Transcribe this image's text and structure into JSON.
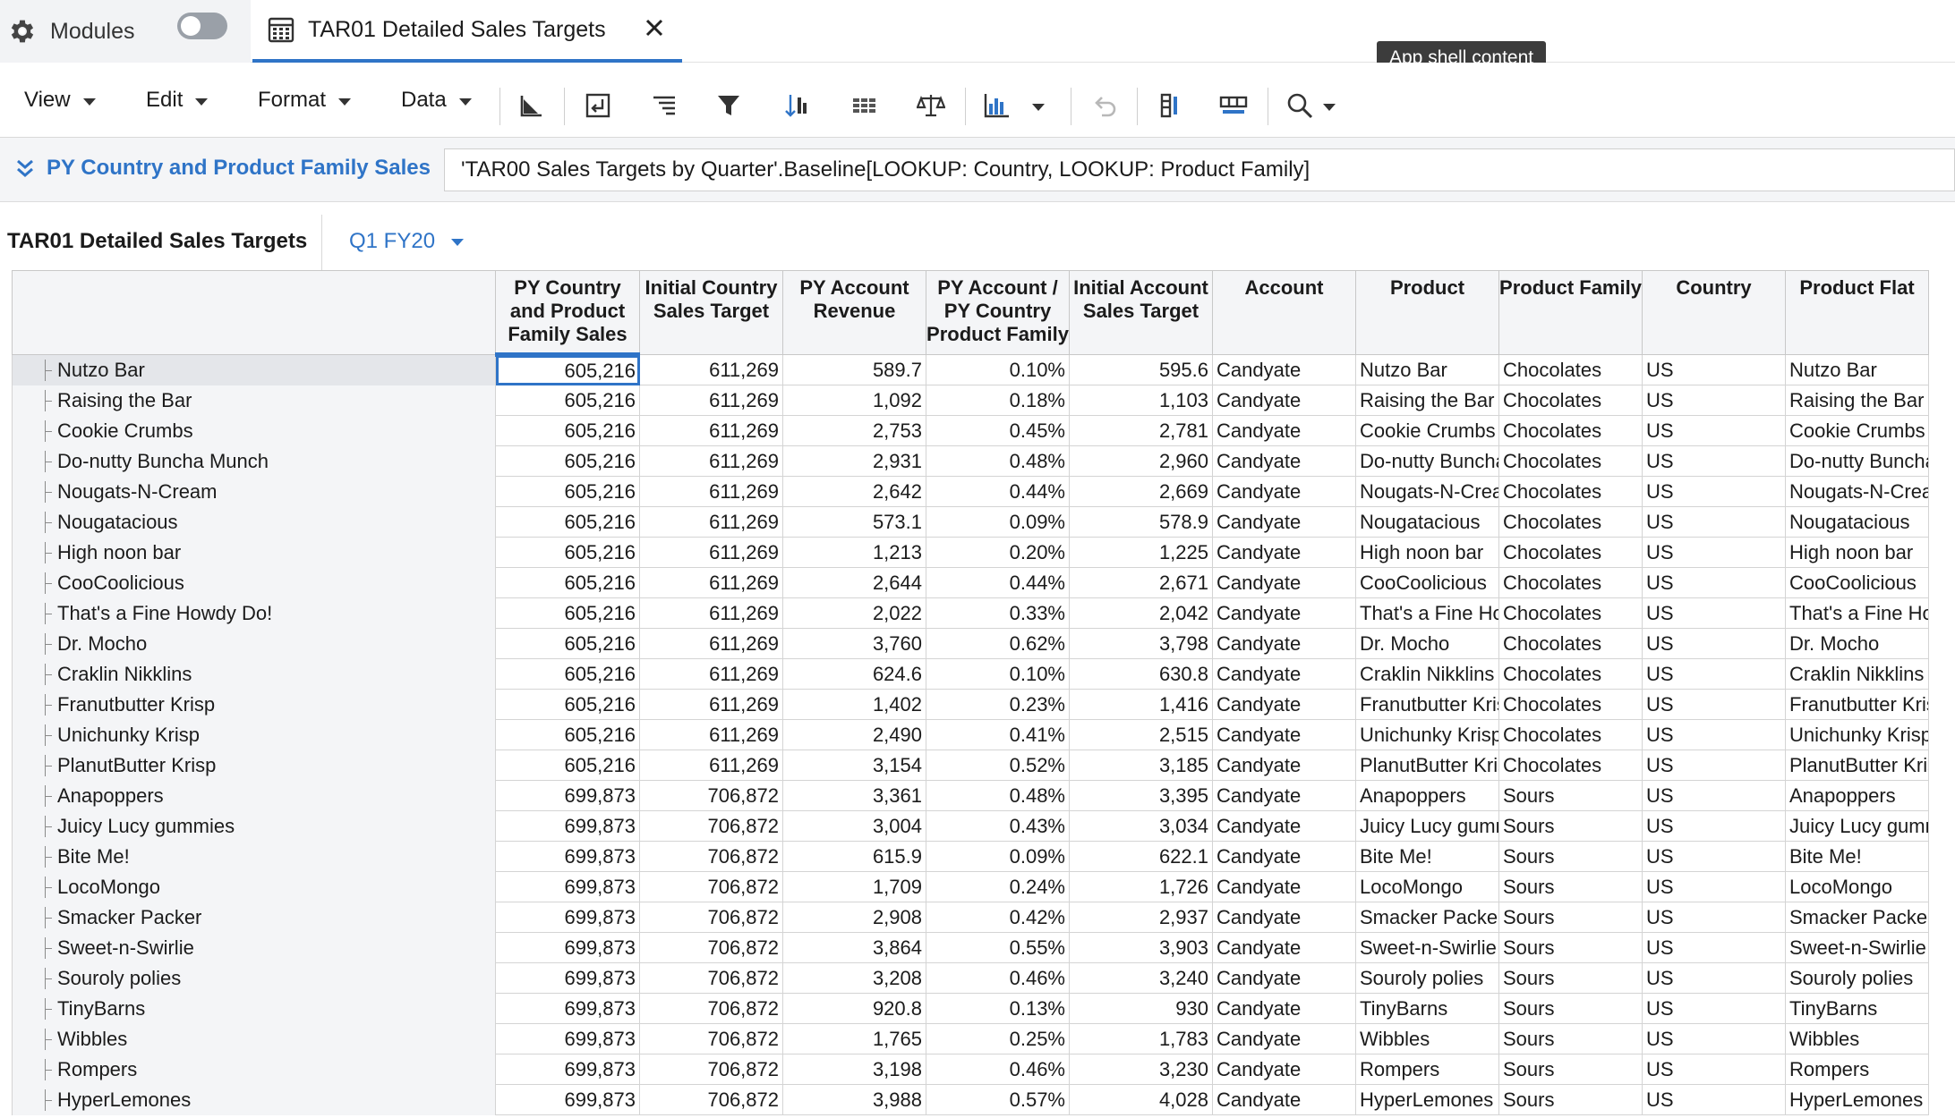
{
  "tabs": {
    "modules_label": "Modules",
    "doc_title": "TAR01 Detailed Sales Targets"
  },
  "tooltip": "App shell content",
  "toolbar": {
    "menus": [
      "View",
      "Edit",
      "Format",
      "Data"
    ]
  },
  "formula": {
    "name": "PY Country and Product Family Sales",
    "expression": "'TAR00 Sales Targets by Quarter'.Baseline[LOOKUP: Country, LOOKUP: Product Family]"
  },
  "grid": {
    "title": "TAR01 Detailed Sales Targets",
    "period": "Q1 FY20",
    "columns": [
      "PY Country and Product Family Sales",
      "Initial Country Sales Target",
      "PY Account Revenue",
      "PY Account / PY Country Product Family",
      "Initial Account Sales Target",
      "Account",
      "Product",
      "Product Family",
      "Country",
      "Product Flat"
    ],
    "rows": [
      [
        "Nutzo Bar",
        "605,216",
        "611,269",
        "589.7",
        "0.10%",
        "595.6",
        "Candyate",
        "Nutzo Bar",
        "Chocolates",
        "US",
        "Nutzo Bar"
      ],
      [
        "Raising the Bar",
        "605,216",
        "611,269",
        "1,092",
        "0.18%",
        "1,103",
        "Candyate",
        "Raising the Bar",
        "Chocolates",
        "US",
        "Raising the Bar"
      ],
      [
        "Cookie Crumbs",
        "605,216",
        "611,269",
        "2,753",
        "0.45%",
        "2,781",
        "Candyate",
        "Cookie Crumbs",
        "Chocolates",
        "US",
        "Cookie Crumbs"
      ],
      [
        "Do-nutty Buncha Munch",
        "605,216",
        "611,269",
        "2,931",
        "0.48%",
        "2,960",
        "Candyate",
        "Do-nutty Buncha Munch",
        "Chocolates",
        "US",
        "Do-nutty Buncha Munch"
      ],
      [
        "Nougats-N-Cream",
        "605,216",
        "611,269",
        "2,642",
        "0.44%",
        "2,669",
        "Candyate",
        "Nougats-N-Cream",
        "Chocolates",
        "US",
        "Nougats-N-Cream"
      ],
      [
        "Nougatacious",
        "605,216",
        "611,269",
        "573.1",
        "0.09%",
        "578.9",
        "Candyate",
        "Nougatacious",
        "Chocolates",
        "US",
        "Nougatacious"
      ],
      [
        "High noon bar",
        "605,216",
        "611,269",
        "1,213",
        "0.20%",
        "1,225",
        "Candyate",
        "High noon bar",
        "Chocolates",
        "US",
        "High noon bar"
      ],
      [
        "CooCoolicious",
        "605,216",
        "611,269",
        "2,644",
        "0.44%",
        "2,671",
        "Candyate",
        "CooCoolicious",
        "Chocolates",
        "US",
        "CooCoolicious"
      ],
      [
        "That's a Fine Howdy Do!",
        "605,216",
        "611,269",
        "2,022",
        "0.33%",
        "2,042",
        "Candyate",
        "That's a Fine Howdy Do!",
        "Chocolates",
        "US",
        "That's a Fine Howdy Do!"
      ],
      [
        "Dr. Mocho",
        "605,216",
        "611,269",
        "3,760",
        "0.62%",
        "3,798",
        "Candyate",
        "Dr. Mocho",
        "Chocolates",
        "US",
        "Dr. Mocho"
      ],
      [
        "Craklin Nikklins",
        "605,216",
        "611,269",
        "624.6",
        "0.10%",
        "630.8",
        "Candyate",
        "Craklin Nikklins",
        "Chocolates",
        "US",
        "Craklin Nikklins"
      ],
      [
        "Franutbutter Krisp",
        "605,216",
        "611,269",
        "1,402",
        "0.23%",
        "1,416",
        "Candyate",
        "Franutbutter Krisp",
        "Chocolates",
        "US",
        "Franutbutter Krisp"
      ],
      [
        "Unichunky Krisp",
        "605,216",
        "611,269",
        "2,490",
        "0.41%",
        "2,515",
        "Candyate",
        "Unichunky Krisp",
        "Chocolates",
        "US",
        "Unichunky Krisp"
      ],
      [
        "PlanutButter Krisp",
        "605,216",
        "611,269",
        "3,154",
        "0.52%",
        "3,185",
        "Candyate",
        "PlanutButter Krisp",
        "Chocolates",
        "US",
        "PlanutButter Krisp"
      ],
      [
        "Anapoppers",
        "699,873",
        "706,872",
        "3,361",
        "0.48%",
        "3,395",
        "Candyate",
        "Anapoppers",
        "Sours",
        "US",
        "Anapoppers"
      ],
      [
        "Juicy Lucy gummies",
        "699,873",
        "706,872",
        "3,004",
        "0.43%",
        "3,034",
        "Candyate",
        "Juicy Lucy gummies",
        "Sours",
        "US",
        "Juicy Lucy gummies"
      ],
      [
        "Bite Me!",
        "699,873",
        "706,872",
        "615.9",
        "0.09%",
        "622.1",
        "Candyate",
        "Bite Me!",
        "Sours",
        "US",
        "Bite Me!"
      ],
      [
        "LocoMongo",
        "699,873",
        "706,872",
        "1,709",
        "0.24%",
        "1,726",
        "Candyate",
        "LocoMongo",
        "Sours",
        "US",
        "LocoMongo"
      ],
      [
        "Smacker Packer",
        "699,873",
        "706,872",
        "2,908",
        "0.42%",
        "2,937",
        "Candyate",
        "Smacker Packer",
        "Sours",
        "US",
        "Smacker Packer"
      ],
      [
        "Sweet-n-Swirlie",
        "699,873",
        "706,872",
        "3,864",
        "0.55%",
        "3,903",
        "Candyate",
        "Sweet-n-Swirlie",
        "Sours",
        "US",
        "Sweet-n-Swirlie"
      ],
      [
        "Souroly polies",
        "699,873",
        "706,872",
        "3,208",
        "0.46%",
        "3,240",
        "Candyate",
        "Souroly polies",
        "Sours",
        "US",
        "Souroly polies"
      ],
      [
        "TinyBarns",
        "699,873",
        "706,872",
        "920.8",
        "0.13%",
        "930",
        "Candyate",
        "TinyBarns",
        "Sours",
        "US",
        "TinyBarns"
      ],
      [
        "Wibbles",
        "699,873",
        "706,872",
        "1,765",
        "0.25%",
        "1,783",
        "Candyate",
        "Wibbles",
        "Sours",
        "US",
        "Wibbles"
      ],
      [
        "Rompers",
        "699,873",
        "706,872",
        "3,198",
        "0.46%",
        "3,230",
        "Candyate",
        "Rompers",
        "Sours",
        "US",
        "Rompers"
      ],
      [
        "HyperLemones",
        "699,873",
        "706,872",
        "3,988",
        "0.57%",
        "4,028",
        "Candyate",
        "HyperLemones",
        "Sours",
        "US",
        "HyperLemones"
      ]
    ]
  },
  "colors": {
    "accent": "#2f74c7",
    "header_bg": "#f4f5f7"
  }
}
